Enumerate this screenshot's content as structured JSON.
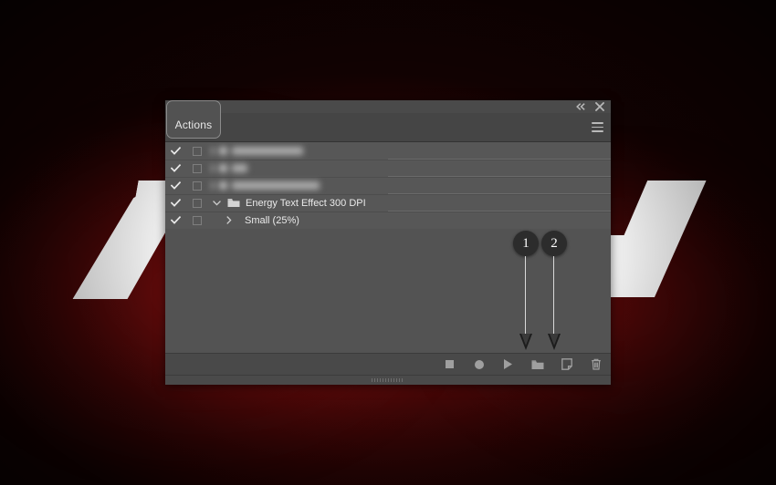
{
  "window": {
    "title": "Actions",
    "controls": [
      {
        "name": "collapse-to-icons",
        "icon": "double-chevron-left-icon"
      },
      {
        "name": "close",
        "icon": "close-icon"
      }
    ],
    "menu_icon": "hamburger-menu-icon"
  },
  "tabs": [
    {
      "label": "Actions",
      "active": true
    }
  ],
  "list": {
    "rows": [
      {
        "checked": true,
        "toggle_box": true,
        "obscured": true,
        "label": "",
        "type": "set"
      },
      {
        "checked": true,
        "toggle_box": true,
        "obscured": true,
        "label": "",
        "type": "set"
      },
      {
        "checked": true,
        "toggle_box": true,
        "obscured": true,
        "label": "",
        "type": "set"
      },
      {
        "checked": true,
        "toggle_box": true,
        "obscured": false,
        "label": "Energy Text Effect 300 DPI",
        "type": "folder",
        "expanded": true
      },
      {
        "checked": true,
        "toggle_box": true,
        "obscured": false,
        "label": "Small (25%)",
        "type": "action",
        "expanded": false
      }
    ]
  },
  "toolbar": {
    "buttons": [
      {
        "name": "stop-button",
        "icon": "stop-square-icon",
        "label": "Stop playing/recording"
      },
      {
        "name": "record-button",
        "icon": "record-circle-icon",
        "label": "Begin recording"
      },
      {
        "name": "play-button",
        "icon": "play-triangle-icon",
        "label": "Play selection"
      },
      {
        "name": "new-set-button",
        "icon": "new-folder-icon",
        "label": "Create new set"
      },
      {
        "name": "new-action-button",
        "icon": "new-action-page-icon",
        "label": "Create new action"
      },
      {
        "name": "delete-button",
        "icon": "trash-icon",
        "label": "Delete"
      }
    ]
  },
  "annotations": [
    {
      "number": "1",
      "target": "new-set-button"
    },
    {
      "number": "2",
      "target": "new-action-button"
    }
  ],
  "colors": {
    "panel_bg": "#454545",
    "list_bg": "#575757",
    "toolbar_bg": "#494949",
    "text": "#eaeaea",
    "icon": "#9f9f9f",
    "badge_bg": "#2c2c2c",
    "backdrop_red": "#6e0d0d"
  }
}
